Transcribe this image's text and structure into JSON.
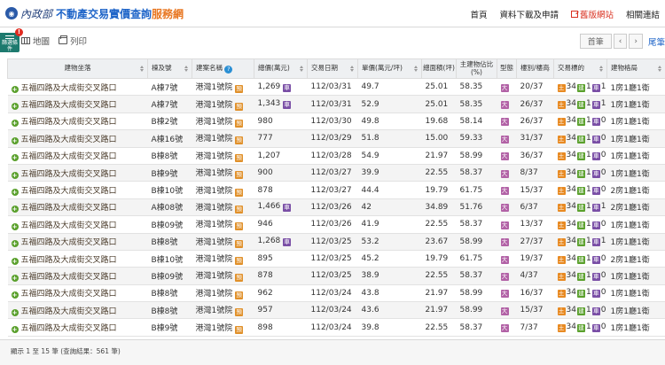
{
  "header": {
    "logo_text": "內政部",
    "title_main": "不動產交易實價查詢",
    "title_accent": "服務網",
    "nav": {
      "home": "首頁",
      "download": "資料下載及申請",
      "old_site": "舊版網站",
      "links": "相關連結"
    }
  },
  "filter_tab": {
    "label": "篩選條件",
    "badge": "!"
  },
  "toolbar": {
    "map": "地圖",
    "print": "列印",
    "pager": {
      "first": "首筆",
      "prev": "‹",
      "next": "›",
      "last": "尾筆"
    }
  },
  "table": {
    "headers": {
      "address": "建物坐落",
      "building": "棟及號",
      "project": "建案名稱",
      "total": "總價(萬元)",
      "date": "交易日期",
      "unit": "單價(萬元/坪)",
      "area": "總面積(坪)",
      "ratio": "主建物佔比(%)",
      "type": "型態",
      "floor": "樓別/樓高",
      "deal": "交易標的",
      "layout": "建物格局"
    },
    "tags": {
      "project": "預",
      "total": "車",
      "type": "大",
      "land": "土",
      "building": "建",
      "car": "車"
    },
    "rows": [
      {
        "address": "五福四路及大成街交叉路口",
        "building": "A棟7號",
        "project": "港灣1號院",
        "total": "1,269",
        "car": true,
        "date": "112/03/31",
        "unit": "49.7",
        "area": "25.01",
        "ratio": "58.35",
        "floor": "20/37",
        "land": "34",
        "bld": "1",
        "cars": "1",
        "layout": "1房1廳1衛"
      },
      {
        "address": "五福四路及大成街交叉路口",
        "building": "A棟7號",
        "project": "港灣1號院",
        "total": "1,343",
        "car": true,
        "date": "112/03/31",
        "unit": "52.9",
        "area": "25.01",
        "ratio": "58.35",
        "floor": "26/37",
        "land": "34",
        "bld": "1",
        "cars": "1",
        "layout": "1房1廳1衛"
      },
      {
        "address": "五福四路及大成街交叉路口",
        "building": "B棟2號",
        "project": "港灣1號院",
        "total": "980",
        "car": false,
        "date": "112/03/30",
        "unit": "49.8",
        "area": "19.68",
        "ratio": "58.14",
        "floor": "26/37",
        "land": "34",
        "bld": "1",
        "cars": "0",
        "layout": "1房1廳1衛"
      },
      {
        "address": "五福四路及大成街交叉路口",
        "building": "A棟16號",
        "project": "港灣1號院",
        "total": "777",
        "car": false,
        "date": "112/03/29",
        "unit": "51.8",
        "area": "15.00",
        "ratio": "59.33",
        "floor": "31/37",
        "land": "34",
        "bld": "1",
        "cars": "0",
        "layout": "1房1廳1衛"
      },
      {
        "address": "五福四路及大成街交叉路口",
        "building": "B棟8號",
        "project": "港灣1號院",
        "total": "1,207",
        "car": false,
        "date": "112/03/28",
        "unit": "54.9",
        "area": "21.97",
        "ratio": "58.99",
        "floor": "36/37",
        "land": "34",
        "bld": "1",
        "cars": "0",
        "layout": "1房1廳1衛"
      },
      {
        "address": "五福四路及大成街交叉路口",
        "building": "B棟9號",
        "project": "港灣1號院",
        "total": "900",
        "car": false,
        "date": "112/03/27",
        "unit": "39.9",
        "area": "22.55",
        "ratio": "58.37",
        "floor": "8/37",
        "land": "34",
        "bld": "1",
        "cars": "0",
        "layout": "1房1廳1衛"
      },
      {
        "address": "五福四路及大成街交叉路口",
        "building": "B棟10號",
        "project": "港灣1號院",
        "total": "878",
        "car": false,
        "date": "112/03/27",
        "unit": "44.4",
        "area": "19.79",
        "ratio": "61.75",
        "floor": "15/37",
        "land": "34",
        "bld": "1",
        "cars": "0",
        "layout": "2房1廳1衛"
      },
      {
        "address": "五福四路及大成街交叉路口",
        "building": "A棟08號",
        "project": "港灣1號院",
        "total": "1,466",
        "car": true,
        "date": "112/03/26",
        "unit": "42",
        "area": "34.89",
        "ratio": "51.76",
        "floor": "6/37",
        "land": "34",
        "bld": "1",
        "cars": "1",
        "layout": "2房1廳1衛"
      },
      {
        "address": "五福四路及大成街交叉路口",
        "building": "B棟09號",
        "project": "港灣1號院",
        "total": "946",
        "car": false,
        "date": "112/03/26",
        "unit": "41.9",
        "area": "22.55",
        "ratio": "58.37",
        "floor": "13/37",
        "land": "34",
        "bld": "1",
        "cars": "0",
        "layout": "1房1廳1衛"
      },
      {
        "address": "五福四路及大成街交叉路口",
        "building": "B棟8號",
        "project": "港灣1號院",
        "total": "1,268",
        "car": true,
        "date": "112/03/25",
        "unit": "53.2",
        "area": "23.67",
        "ratio": "58.99",
        "floor": "27/37",
        "land": "34",
        "bld": "1",
        "cars": "1",
        "layout": "1房1廳1衛"
      },
      {
        "address": "五福四路及大成街交叉路口",
        "building": "B棟10號",
        "project": "港灣1號院",
        "total": "895",
        "car": false,
        "date": "112/03/25",
        "unit": "45.2",
        "area": "19.79",
        "ratio": "61.75",
        "floor": "19/37",
        "land": "34",
        "bld": "1",
        "cars": "0",
        "layout": "2房1廳1衛"
      },
      {
        "address": "五福四路及大成街交叉路口",
        "building": "B棟09號",
        "project": "港灣1號院",
        "total": "878",
        "car": false,
        "date": "112/03/25",
        "unit": "38.9",
        "area": "22.55",
        "ratio": "58.37",
        "floor": "4/37",
        "land": "34",
        "bld": "1",
        "cars": "0",
        "layout": "1房1廳1衛"
      },
      {
        "address": "五福四路及大成街交叉路口",
        "building": "B棟8號",
        "project": "港灣1號院",
        "total": "962",
        "car": false,
        "date": "112/03/24",
        "unit": "43.8",
        "area": "21.97",
        "ratio": "58.99",
        "floor": "16/37",
        "land": "34",
        "bld": "1",
        "cars": "0",
        "layout": "1房1廳1衛"
      },
      {
        "address": "五福四路及大成街交叉路口",
        "building": "B棟8號",
        "project": "港灣1號院",
        "total": "957",
        "car": false,
        "date": "112/03/24",
        "unit": "43.6",
        "area": "21.97",
        "ratio": "58.99",
        "floor": "15/37",
        "land": "34",
        "bld": "1",
        "cars": "0",
        "layout": "1房1廳1衛"
      },
      {
        "address": "五福四路及大成街交叉路口",
        "building": "B棟9號",
        "project": "港灣1號院",
        "total": "898",
        "car": false,
        "date": "112/03/24",
        "unit": "39.8",
        "area": "22.55",
        "ratio": "58.37",
        "floor": "7/37",
        "land": "34",
        "bld": "1",
        "cars": "0",
        "layout": "1房1廳1衛"
      }
    ]
  },
  "footer": {
    "text": "顯示 1 至 15 筆 (查詢結果：561 筆)"
  },
  "colors": {
    "brand_blue": "#1e64c8",
    "brand_orange": "#e87722",
    "filter_green": "#1d7a6e",
    "alert_red": "#e02b20"
  }
}
